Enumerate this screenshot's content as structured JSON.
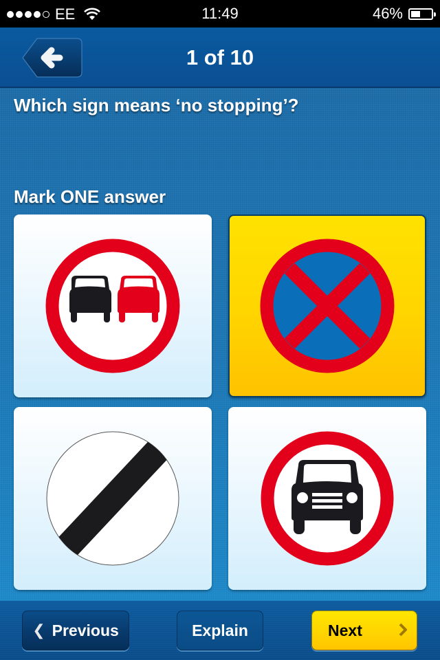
{
  "status_bar": {
    "signal_bars_filled": 4,
    "signal_bars_total": 5,
    "carrier": "EE",
    "wifi_icon": "wifi-icon",
    "time": "11:49",
    "battery_percent_label": "46%",
    "battery_level": 0.46
  },
  "nav": {
    "back_icon": "arrow-left-icon",
    "title": "1 of 10"
  },
  "question": {
    "text": "Which sign means ‘no stopping’?",
    "instruction": "Mark ONE answer"
  },
  "answers": [
    {
      "sign": "no-overtaking-sign",
      "description": "Red ring with black and red cars side by side",
      "selected": false
    },
    {
      "sign": "no-stopping-clearway-sign",
      "description": "Blue disc with red ring and red cross",
      "selected": true
    },
    {
      "sign": "national-speed-limit-sign",
      "description": "White disc with black diagonal stripe",
      "selected": false
    },
    {
      "sign": "no-motor-vehicles-sign",
      "description": "Red ring with black car front view",
      "selected": false
    }
  ],
  "toolbar": {
    "previous_label": "Previous",
    "previous_icon": "chevron-left-icon",
    "explain_label": "Explain",
    "next_label": "Next",
    "next_icon": "chevron-right-icon"
  },
  "colors": {
    "sign_red": "#e2001a",
    "sign_blue": "#0a6fb8",
    "selected_yellow": "#ffd600",
    "nav_blue": "#0b4f92"
  }
}
